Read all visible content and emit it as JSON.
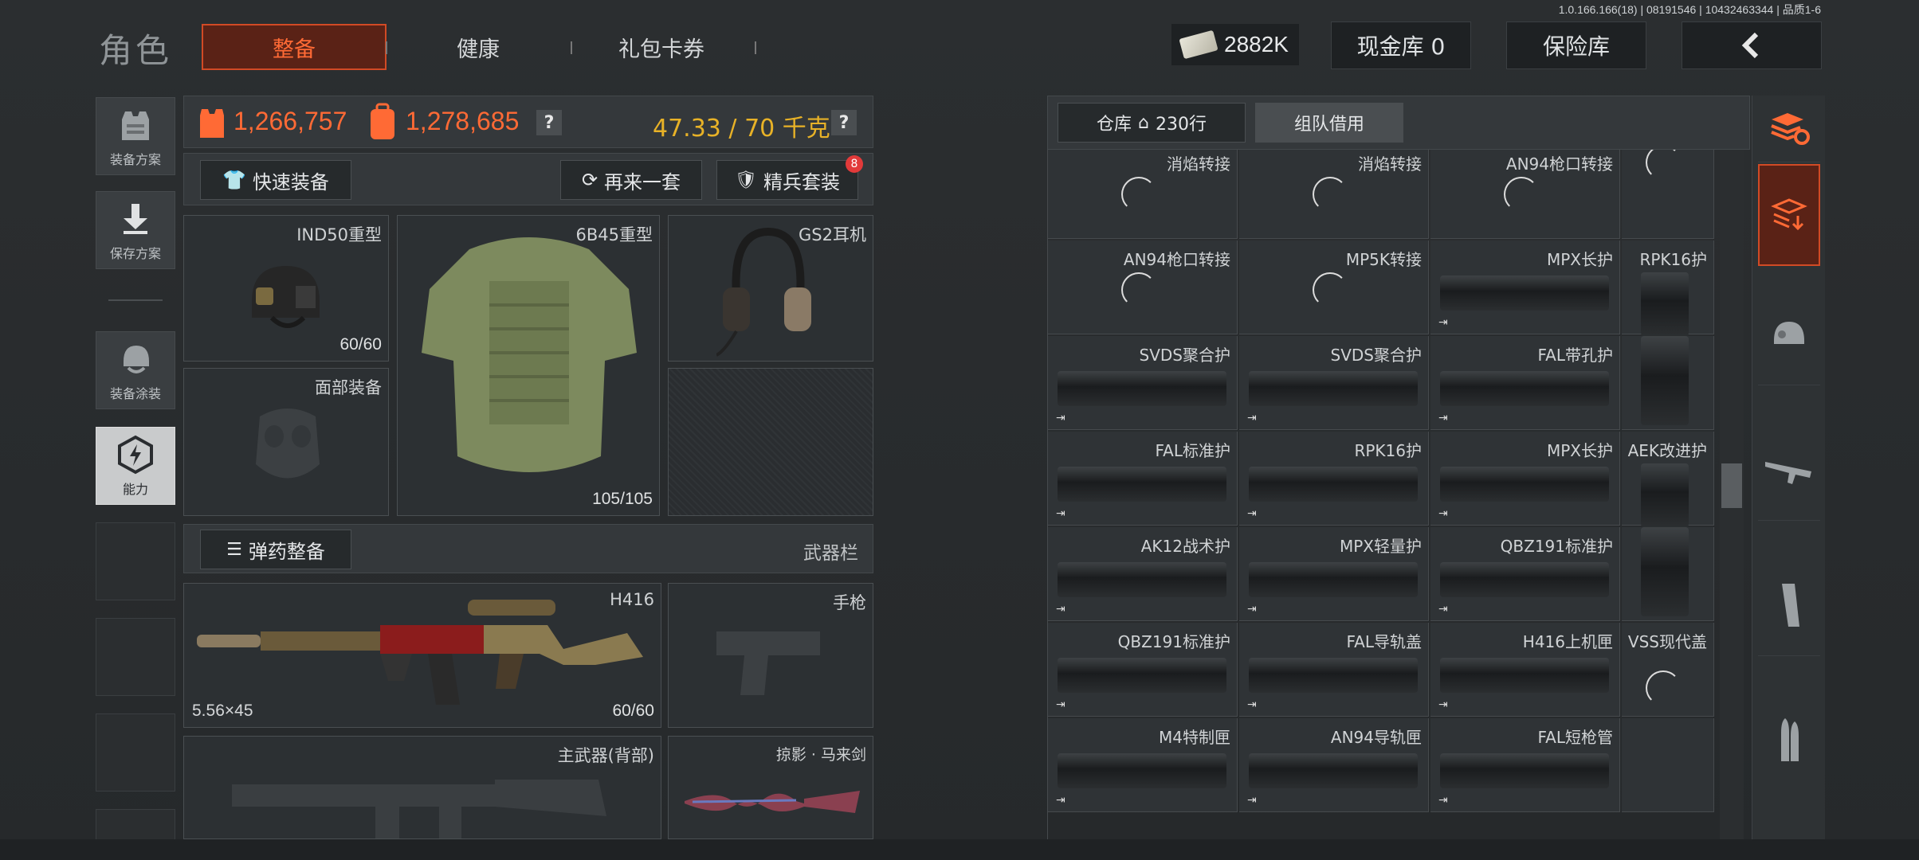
{
  "version": "1.0.166.166(18) | 08191546 | 10432463344 | 品质1-6",
  "header": {
    "title": "角色",
    "tabs": [
      "整备",
      "健康",
      "礼包卡券"
    ],
    "currency": "2882K",
    "cash_storage": "现金库 0",
    "vault": "保险库",
    "back_icon": "chevron-left-icon"
  },
  "sidebar": {
    "items": [
      {
        "label": "装备方案",
        "icon": "vest-icon"
      },
      {
        "label": "保存方案",
        "icon": "download-icon"
      },
      {
        "label": "装备涂装",
        "icon": "helmet-paint-icon"
      },
      {
        "label": "能力",
        "icon": "ability-icon"
      }
    ]
  },
  "stats": {
    "armor_value": "1,266,757",
    "backpack_value": "1,278,685",
    "weight": "47.33 / 70 千克",
    "help": "?"
  },
  "buttons": {
    "quick_equip": "快速装备",
    "again": "再来一套",
    "elite": "精兵套装",
    "elite_badge": "8",
    "ammo": "弹药整备",
    "weapon_bar": "武器栏"
  },
  "gear": {
    "helmet": {
      "name": "IND50重型",
      "count": "60/60"
    },
    "armor": {
      "name": "6B45重型",
      "count": "105/105"
    },
    "headset": {
      "name": "GS2耳机"
    },
    "face": {
      "name": "面部装备"
    },
    "primary": {
      "name": "H416",
      "ammo": "5.56×45",
      "count": "60/60"
    },
    "pistol": {
      "name": "手枪"
    },
    "secondary": {
      "name": "主武器(背部)"
    },
    "melee": {
      "name": "掠影 · 马来剑"
    }
  },
  "storage": {
    "tab_warehouse": "仓库",
    "rows": "230行",
    "tab_team": "组队借用",
    "items": [
      {
        "label": "消焰转接",
        "type": "spinner"
      },
      {
        "label": "消焰转接",
        "type": "spinner"
      },
      {
        "label": "AN94枪口转接",
        "type": "spinner"
      },
      {
        "label": "",
        "type": "spinner"
      },
      {
        "label": "AN94枪口转接",
        "type": "spinner"
      },
      {
        "label": "MP5K转接",
        "type": "spinner"
      },
      {
        "label": "MPX长护",
        "type": "part"
      },
      {
        "label": "RPK16护",
        "type": "tall"
      },
      {
        "label": "SVDS聚合护",
        "type": "part"
      },
      {
        "label": "SVDS聚合护",
        "type": "part"
      },
      {
        "label": "FAL带孔护",
        "type": "part"
      },
      {
        "label": "",
        "type": "tall-cont"
      },
      {
        "label": "FAL标准护",
        "type": "part"
      },
      {
        "label": "RPK16护",
        "type": "part"
      },
      {
        "label": "MPX长护",
        "type": "part"
      },
      {
        "label": "AEK改进护",
        "type": "tall"
      },
      {
        "label": "AK12战术护",
        "type": "part"
      },
      {
        "label": "MPX轻量护",
        "type": "part"
      },
      {
        "label": "QBZ191标准护",
        "type": "part"
      },
      {
        "label": "",
        "type": "tall-cont"
      },
      {
        "label": "QBZ191标准护",
        "type": "part"
      },
      {
        "label": "FAL导轨盖",
        "type": "part"
      },
      {
        "label": "H416上机匣",
        "type": "part"
      },
      {
        "label": "VSS现代盖",
        "type": "spinner"
      },
      {
        "label": "M4特制匣",
        "type": "part"
      },
      {
        "label": "AN94导轨匣",
        "type": "part"
      },
      {
        "label": "FAL短枪管",
        "type": "part"
      },
      {
        "label": "",
        "type": "empty"
      }
    ]
  },
  "right_sidebar": [
    "stack-refresh-icon",
    "stack-download-icon",
    "helmet-icon",
    "rifle-icon",
    "magazine-icon",
    "ammo-icon"
  ]
}
